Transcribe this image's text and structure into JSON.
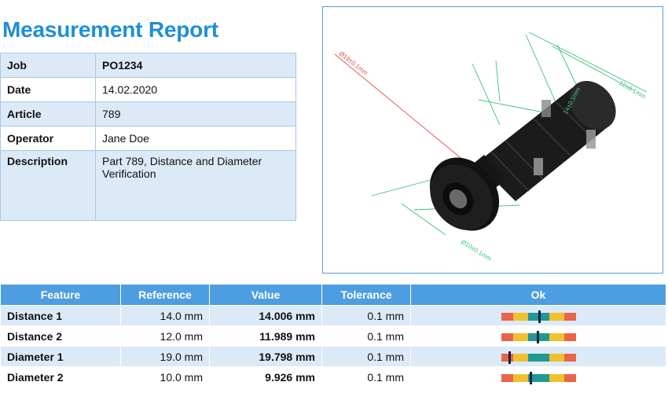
{
  "title": "Measurement Report",
  "info": [
    {
      "label": "Job",
      "value": "PO1234"
    },
    {
      "label": "Date",
      "value": "14.02.2020"
    },
    {
      "label": "Article",
      "value": "789"
    },
    {
      "label": "Operator",
      "value": "Jane Doe"
    },
    {
      "label": "Description",
      "value": "Part 789, Distance and Diameter Verification"
    }
  ],
  "view_labels": {
    "d19": "Ø19±0.1mm",
    "d10": "Ø10±0.1mm",
    "l12": "12±0.1mm",
    "l14": "14±0.1mm"
  },
  "results": {
    "headers": [
      "Feature",
      "Reference",
      "Value",
      "Tolerance",
      "Ok"
    ],
    "rows": [
      {
        "feature": "Distance 1",
        "reference": "14.0 mm",
        "value": "14.006 mm",
        "tolerance": "0.1 mm",
        "deviation": 0.006
      },
      {
        "feature": "Distance 2",
        "reference": "12.0 mm",
        "value": "11.989 mm",
        "tolerance": "0.1 mm",
        "deviation": -0.011
      },
      {
        "feature": "Diameter 1",
        "reference": "19.0 mm",
        "value": "19.798 mm",
        "tolerance": "0.1 mm",
        "deviation": -0.28
      },
      {
        "feature": "Diameter 2",
        "reference": "10.0 mm",
        "value": "9.926 mm",
        "tolerance": "0.1 mm",
        "deviation": -0.074
      }
    ]
  },
  "colors": {
    "title": "#1f8fd6",
    "header_bg": "#4d9ee0",
    "row_bg": "#dce9f6",
    "out_of_tolerance": "#e8654a",
    "warning": "#efc12f",
    "in_tolerance": "#219894",
    "marker": "#152045"
  }
}
